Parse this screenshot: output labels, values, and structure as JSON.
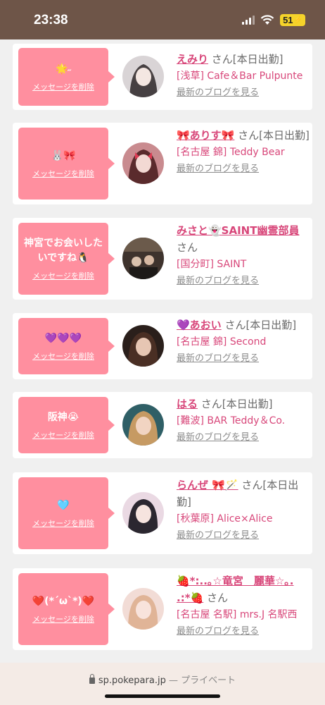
{
  "status": {
    "time": "23:38",
    "battery": "51"
  },
  "messages": [
    {
      "bubble_text": "🌟˶",
      "delete_label": "メッセージを削除",
      "name": "えみり",
      "suffix": " さん[本日出勤]",
      "shop": "[浅草] Cafe＆Bar Pulpunte",
      "blog_label": "最新のブログを見る",
      "avatar_color": "#b9b3b6"
    },
    {
      "bubble_text": "🐰🎀",
      "delete_label": "メッセージを削除",
      "name": "🎀ありす🎀",
      "suffix": " さん[本日出勤]",
      "shop": "[名古屋 錦] Teddy Bear",
      "blog_label": "最新のブログを見る",
      "avatar_color": "#9a4a4f"
    },
    {
      "bubble_text": "神宮でお会いしたいですね🐧",
      "delete_label": "メッセージを削除",
      "name": "みさと👻SAINT幽霊部員",
      "suffix": " さん",
      "shop": "[国分町] SAINT",
      "blog_label": "最新のブログを見る",
      "avatar_color": "#4b3f38"
    },
    {
      "bubble_text": "💜💜💜",
      "delete_label": "メッセージを削除",
      "name": "💜あおい",
      "suffix": " さん[本日出勤]",
      "shop": "[名古屋 錦] Second",
      "blog_label": "最新のブログを見る",
      "avatar_color": "#3a2a24"
    },
    {
      "bubble_text": "阪神😭",
      "delete_label": "メッセージを削除",
      "name": "はる",
      "suffix": " さん[本日出勤]",
      "shop": "[難波] BAR Teddy＆Co.",
      "blog_label": "最新のブログを見る",
      "avatar_color": "#6f5b47"
    },
    {
      "bubble_text": "🩵",
      "delete_label": "メッセージを削除",
      "name": "らんぜ 🎀🪄",
      "suffix": " さん[本日出勤]",
      "shop": "[秋葉原] Alice×Alice",
      "blog_label": "最新のブログを見る",
      "avatar_color": "#c9b7c6"
    },
    {
      "bubble_text": "❤️(*´ω`*)❤️",
      "delete_label": "メッセージを削除",
      "name": "🍓*:..｡☆竜宮　麗華☆｡. .:*🍓",
      "suffix": " さん",
      "shop": "[名古屋 名駅] mrs.J 名駅西",
      "blog_label": "最新のブログを見る",
      "avatar_color": "#e8c4bb"
    }
  ],
  "browser": {
    "url": "sp.pokepara.jp",
    "mode": "— プライベート"
  }
}
